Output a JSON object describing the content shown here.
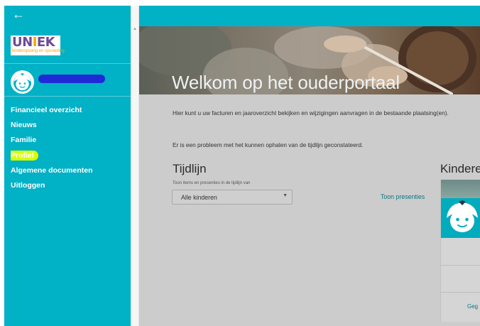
{
  "sidebar": {
    "logo": {
      "brand_prefix": "UN",
      "brand_accent": "I",
      "brand_suffix": "EK",
      "tagline": "kinderopvang en opvoeding"
    },
    "items": [
      {
        "label": "Financieel overzicht",
        "highlighted": false
      },
      {
        "label": "Nieuws",
        "highlighted": false
      },
      {
        "label": "Familie",
        "highlighted": false
      },
      {
        "label": "Profiel",
        "highlighted": true
      },
      {
        "label": "Algemene documenten",
        "highlighted": false
      },
      {
        "label": "Uitloggen",
        "highlighted": false
      }
    ]
  },
  "header": {
    "back_icon": "arrow-left-icon",
    "hero_title": "Welkom op het ouderportaal"
  },
  "main": {
    "intro_text": "Hier kunt u uw facturen en jaaroverzicht bekijken en wijzigingen aanvragen in de bestaande plaatsing(en).",
    "error_text": "Er is een probleem met het kunnen ophalen van de tijdlijn geconstateerd.",
    "timeline": {
      "title": "Tijdlijn",
      "filter_label": "Toon items en presenties in de tijdlijn van",
      "select_value": "Alle kinderen",
      "presence_link": "Toon presenties"
    },
    "children": {
      "title": "Kinderen",
      "link_label": "Geg"
    }
  },
  "colors": {
    "accent": "#01b1c6",
    "highlight": "#d9ff00",
    "link": "#0c7584",
    "overlay": "#cccccc"
  }
}
